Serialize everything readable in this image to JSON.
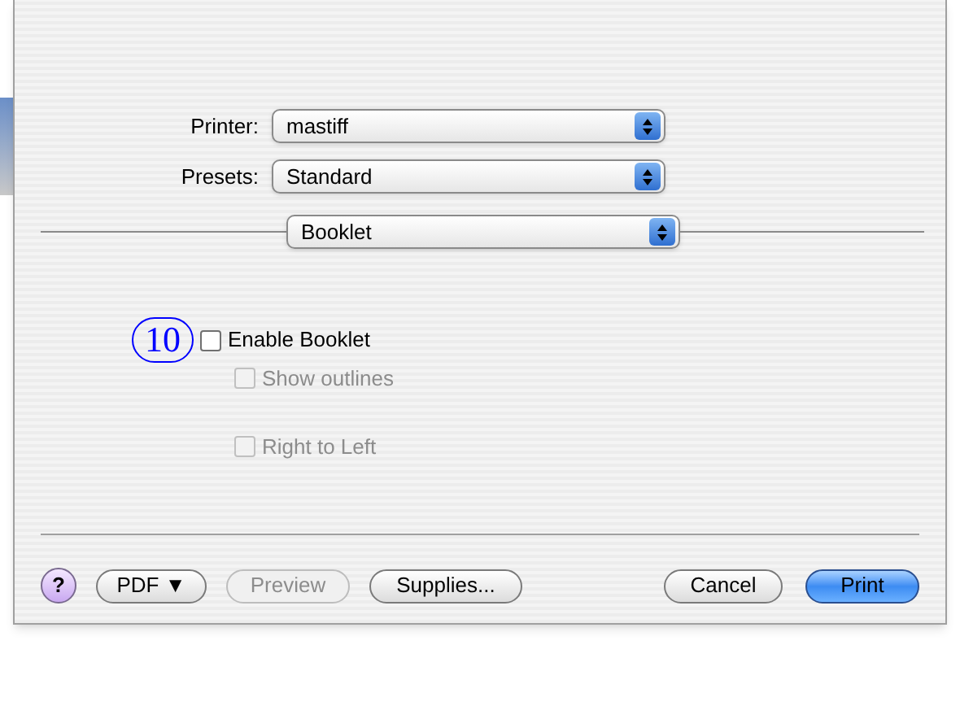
{
  "fields": [
    {
      "label": "Printer:",
      "value": "mastiff"
    },
    {
      "label": "Presets:",
      "value": "Standard"
    }
  ],
  "panel_menu": {
    "value": "Booklet"
  },
  "callout": "10",
  "options": [
    {
      "label": "Enable Booklet",
      "checked": false,
      "disabled": false
    },
    {
      "label": "Show outlines",
      "checked": false,
      "disabled": true
    },
    {
      "label": "Right to Left",
      "checked": false,
      "disabled": true
    }
  ],
  "buttons": [
    {
      "kind": "help",
      "label": "?"
    },
    {
      "kind": "menu",
      "label": "PDF ▼"
    },
    {
      "kind": "plain",
      "label": "Preview",
      "disabled": true
    },
    {
      "kind": "plain",
      "label": "Supplies..."
    },
    {
      "kind": "plain",
      "label": "Cancel"
    },
    {
      "kind": "default",
      "label": "Print"
    }
  ]
}
